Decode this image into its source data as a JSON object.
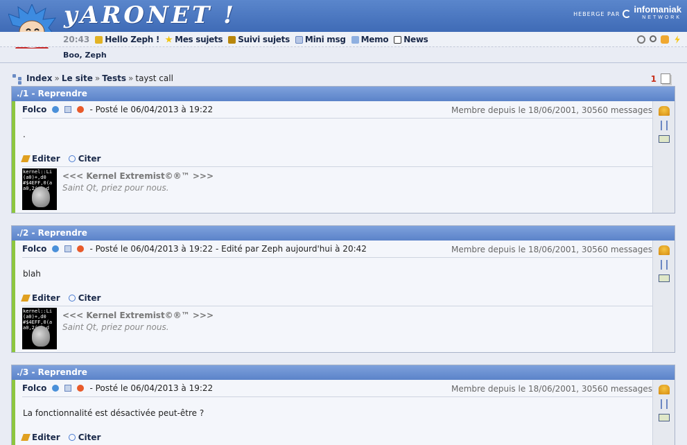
{
  "header": {
    "logo_text": "yARONET !",
    "hosted_by": "HEBERGE PAR",
    "host_brand": "infomaniak",
    "host_brand_sub": "NETWORK"
  },
  "nav": {
    "time": "20:43",
    "items": [
      {
        "label": "Hello Zeph !",
        "icon": "music-note-icon"
      },
      {
        "label": "Mes sujets",
        "icon": "star-icon"
      },
      {
        "label": "Suivi sujets",
        "icon": "book-icon"
      },
      {
        "label": "Mini msg",
        "icon": "envelope-icon"
      },
      {
        "label": "Memo",
        "icon": "notepad-icon"
      },
      {
        "label": "News",
        "icon": "news-icon"
      }
    ],
    "tools": [
      "gear-icon",
      "search-icon",
      "chat-icon",
      "lightning-icon"
    ]
  },
  "online_users": "Boo, Zeph",
  "breadcrumb": {
    "items": [
      "Index",
      "Le site",
      "Tests"
    ],
    "current": "tayst call",
    "separator": "»"
  },
  "pagination": {
    "current_page": "1"
  },
  "posts": [
    {
      "header": "./1 - Reprendre",
      "author": "Folco",
      "posted": "- Posté le 06/04/2013 à 19:22",
      "member_info": "Membre depuis le 18/06/2001, 30560 messages",
      "content": ".",
      "edit_label": "Editer",
      "quote_label": "Citer",
      "sig_line1": "<<< Kernel Extremist©®™ >>>",
      "sig_line2": "Saint Qt, priez pour nous.",
      "avatar_text": "kernel::Li\n(a0)+,d0\n#$4EFF,0(a\na0,2(a),d"
    },
    {
      "header": "./2 - Reprendre",
      "author": "Folco",
      "posted": "- Posté le 06/04/2013 à 19:22 - Edité par Zeph aujourd'hui à 20:42",
      "member_info": "Membre depuis le 18/06/2001, 30560 messages",
      "content": "blah",
      "edit_label": "Editer",
      "quote_label": "Citer",
      "sig_line1": "<<< Kernel Extremist©®™ >>>",
      "sig_line2": "Saint Qt, priez pour nous.",
      "avatar_text": "kernel::Li\n(a0)+,d0\n#$4EFF,0(a\na0,2(a),d"
    },
    {
      "header": "./3 - Reprendre",
      "author": "Folco",
      "posted": "- Posté le 06/04/2013 à 19:22",
      "member_info": "Membre depuis le 18/06/2001, 30560 messages",
      "content": "La fonctionnalité est désactivée peut-être ?",
      "edit_label": "Editer",
      "quote_label": "Citer"
    }
  ],
  "colors": {
    "header_blue": "#4a76c0",
    "post_accent": "#8dc63f",
    "page_number": "#c8311d"
  }
}
